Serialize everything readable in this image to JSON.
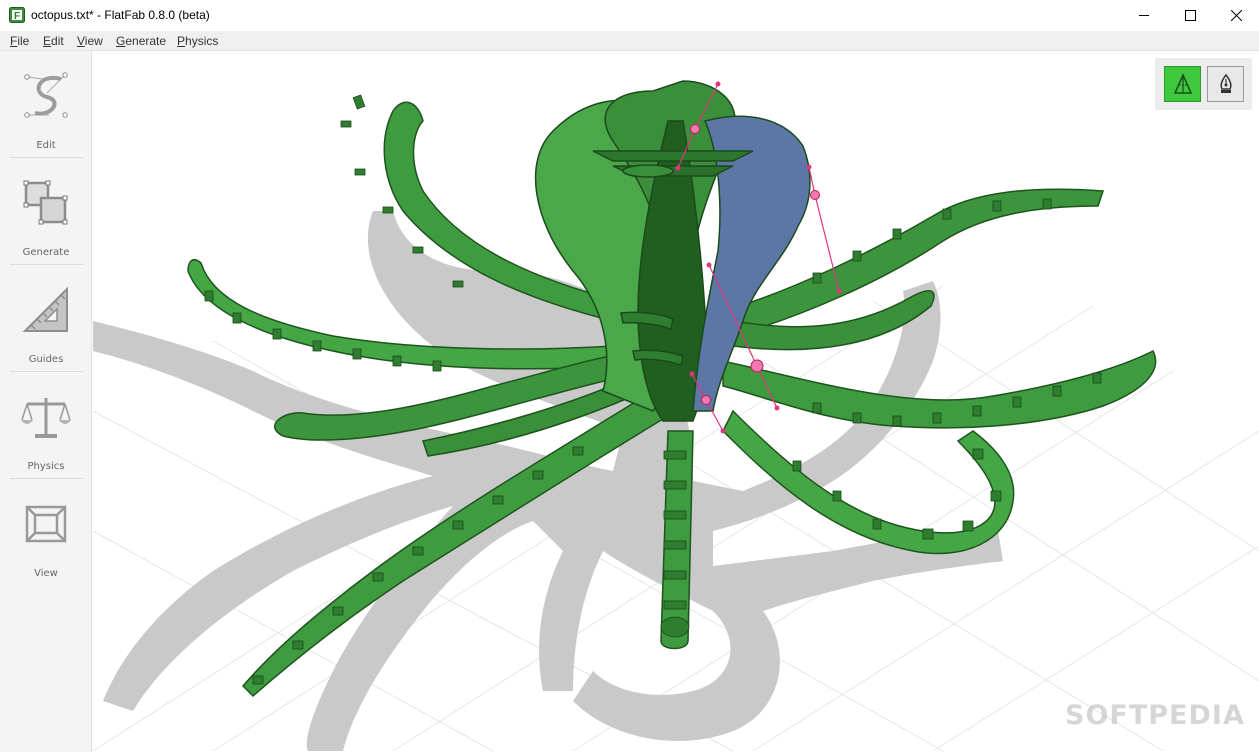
{
  "window": {
    "title": "octopus.txt* - FlatFab 0.8.0 (beta)",
    "icon_letter": "F"
  },
  "menu": [
    {
      "label": "File",
      "key": "F",
      "rest": "ile"
    },
    {
      "label": "Edit",
      "key": "E",
      "rest": "dit"
    },
    {
      "label": "View",
      "key": "V",
      "rest": "iew"
    },
    {
      "label": "Generate",
      "key": "G",
      "rest": "enerate"
    },
    {
      "label": "Physics",
      "key": "P",
      "rest": "hysics"
    }
  ],
  "sidebar": {
    "tools": [
      {
        "label": "Edit",
        "icon": "curve-edit-icon"
      },
      {
        "label": "Generate",
        "icon": "generate-squares-icon"
      },
      {
        "label": "Guides",
        "icon": "triangle-ruler-icon"
      },
      {
        "label": "Physics",
        "icon": "balance-scale-icon"
      },
      {
        "label": "View",
        "icon": "view-frame-icon"
      }
    ]
  },
  "viewport": {
    "mode_buttons": [
      {
        "name": "slice-mode",
        "icon": "slice-planes-icon",
        "active": true
      },
      {
        "name": "pen-mode",
        "icon": "pen-nib-icon",
        "active": false
      }
    ],
    "colors": {
      "part_green": "#3f9b3f",
      "part_dark": "#215f21",
      "part_light": "#55b255",
      "selected_blue": "#5c77a6",
      "control_pink": "#e0367f",
      "shadow": "#c9c9c9",
      "grid": "#e6e6e6"
    }
  },
  "watermark": "SOFTPEDIA"
}
